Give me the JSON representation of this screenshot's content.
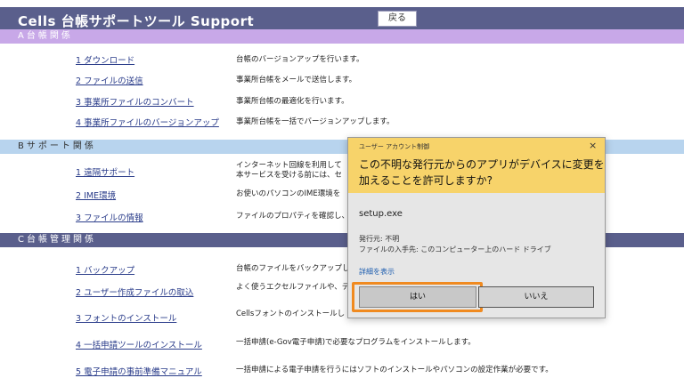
{
  "header": {
    "title": "Cells  台帳サポートツール    Support",
    "back_label": "戻る"
  },
  "sections": {
    "a": "A台帳関係",
    "b": "Bサポート関係",
    "c": "C台帳管理関係"
  },
  "menu": {
    "a": [
      {
        "label": "1  ダウンロード",
        "desc": "台帳のバージョンアップを行います。"
      },
      {
        "label": "2  ファイルの送信",
        "desc": "事業所台帳をメールで送信します。"
      },
      {
        "label": "3  事業所ファイルのコンバート",
        "desc": "事業所台帳の最適化を行います。"
      },
      {
        "label": "4  事業所ファイルのバージョンアップ",
        "desc": "事業所台帳を一括でバージョンアップします。"
      }
    ],
    "b": [
      {
        "label": "1  遠隔サポート",
        "desc1": "インターネット回線を利用して",
        "desc2": "本サービスを受ける前には、セ"
      },
      {
        "label": "2  IME環境",
        "desc": "お使いのパソコンのIME環境を"
      },
      {
        "label": "3  ファイルの情報",
        "desc": "ファイルのプロパティを確認し、"
      }
    ],
    "c": [
      {
        "label": "1  バックアップ",
        "desc": "台帳のファイルをバックアップし"
      },
      {
        "label": "2  ユーザー作成ファイルの取込",
        "desc": "よく使うエクセルファイルや、テ"
      },
      {
        "label": "3  フォントのインストール",
        "desc": "Cellsフォントのインストールし"
      },
      {
        "label": "4  一括申請ツールのインストール",
        "desc": "一括申請(e-Gov電子申請)で必要なプログラムをインストールします。"
      },
      {
        "label": "5  電子申請の事前準備マニュアル",
        "desc": "一括申請による電子申請を行うにはソフトのインストールやパソコンの設定作業が必要です。"
      }
    ]
  },
  "uac": {
    "small_title": "ユーザー アカウント制御",
    "close": "×",
    "question_line1": "この不明な発行元からのアプリがデバイスに変更を",
    "question_line2": "加えることを許可しますか?",
    "filename": "setup.exe",
    "publisher": "発行元: 不明",
    "origin": "ファイルの入手先: このコンピューター上のハード ドライブ",
    "details": "詳細を表示",
    "yes": "はい",
    "no": "いいえ"
  },
  "colors": {
    "header_bg": "#5a5f8c",
    "section_a_bg": "#c8a8e8",
    "section_b_bg": "#b8d4ee",
    "uac_header": "#f7d36a",
    "highlight": "#f08a20",
    "link": "#2a3c8a"
  }
}
